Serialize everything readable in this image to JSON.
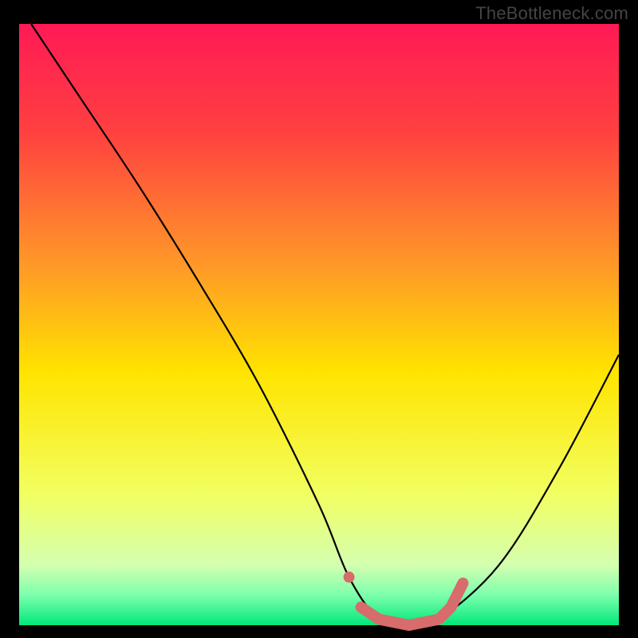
{
  "watermark": "TheBottleneck.com",
  "chart_data": {
    "type": "line",
    "title": "",
    "xlabel": "",
    "ylabel": "",
    "xlim": [
      0,
      100
    ],
    "ylim": [
      0,
      100
    ],
    "gradient_stops": [
      {
        "offset": 0,
        "color": "#ff1a55"
      },
      {
        "offset": 18,
        "color": "#ff4040"
      },
      {
        "offset": 40,
        "color": "#ff9828"
      },
      {
        "offset": 58,
        "color": "#ffe400"
      },
      {
        "offset": 78,
        "color": "#f2ff60"
      },
      {
        "offset": 90,
        "color": "#d4ffb0"
      },
      {
        "offset": 95,
        "color": "#7cffad"
      },
      {
        "offset": 100,
        "color": "#00e87a"
      }
    ],
    "series": [
      {
        "name": "bottleneck-curve",
        "color": "#000000",
        "x": [
          2,
          10,
          20,
          30,
          40,
          50,
          55,
          60,
          65,
          70,
          80,
          90,
          100
        ],
        "y": [
          100,
          88,
          73,
          57,
          40,
          20,
          8,
          1,
          0,
          1,
          10,
          26,
          45
        ]
      }
    ],
    "highlight": {
      "name": "optimal-range",
      "color": "#d86b6b",
      "points": [
        {
          "x": 55,
          "y": 8
        },
        {
          "x": 57,
          "y": 3
        },
        {
          "x": 60,
          "y": 1
        },
        {
          "x": 65,
          "y": 0
        },
        {
          "x": 70,
          "y": 1
        },
        {
          "x": 72,
          "y": 3
        },
        {
          "x": 74,
          "y": 7
        }
      ]
    }
  }
}
